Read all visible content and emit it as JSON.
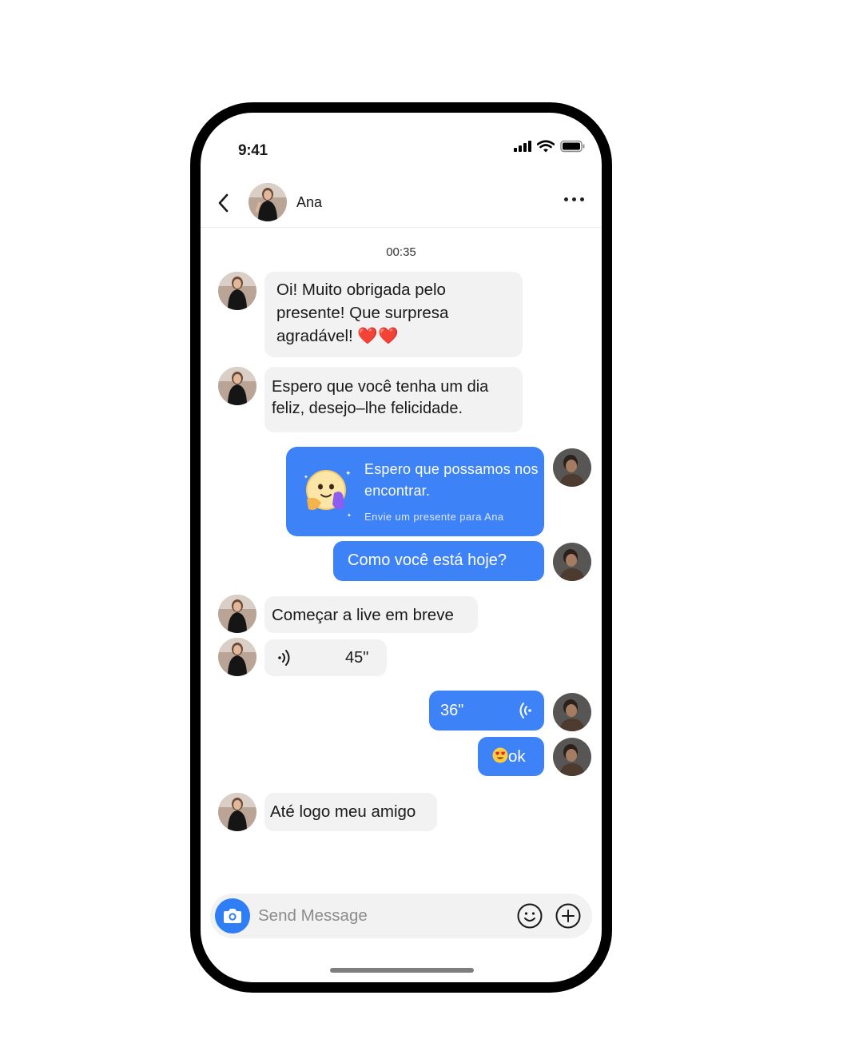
{
  "status_bar": {
    "time": "9:41"
  },
  "header": {
    "contact_name": "Ana"
  },
  "timestamp": "00:35",
  "messages": [
    {
      "side": "in",
      "text": "Oi! Muito obrigada pelo presente! Que surpresa agradável! ❤️❤️"
    },
    {
      "side": "in",
      "text": "Espero que você tenha um dia feliz, desejo–lhe felicidade."
    },
    {
      "side": "out",
      "type": "gift",
      "title": "Espero que possamos nos encontrar.",
      "subtitle": "Envie um presente para Ana"
    },
    {
      "side": "out",
      "text": "Como você está hoje?"
    },
    {
      "side": "in",
      "text": "Começar a live em breve"
    },
    {
      "side": "in",
      "type": "voice",
      "duration": "45\""
    },
    {
      "side": "out",
      "type": "voice",
      "duration": "36\""
    },
    {
      "side": "out",
      "text": "ok",
      "emoji": "heart-eyes-emoji"
    },
    {
      "side": "in",
      "text": "Até logo meu amigo"
    }
  ],
  "composer": {
    "placeholder": "Send Message"
  },
  "colors": {
    "accent": "#3d82f7",
    "incoming_bubble": "#f2f2f2",
    "camera": "#2f7ef5"
  }
}
